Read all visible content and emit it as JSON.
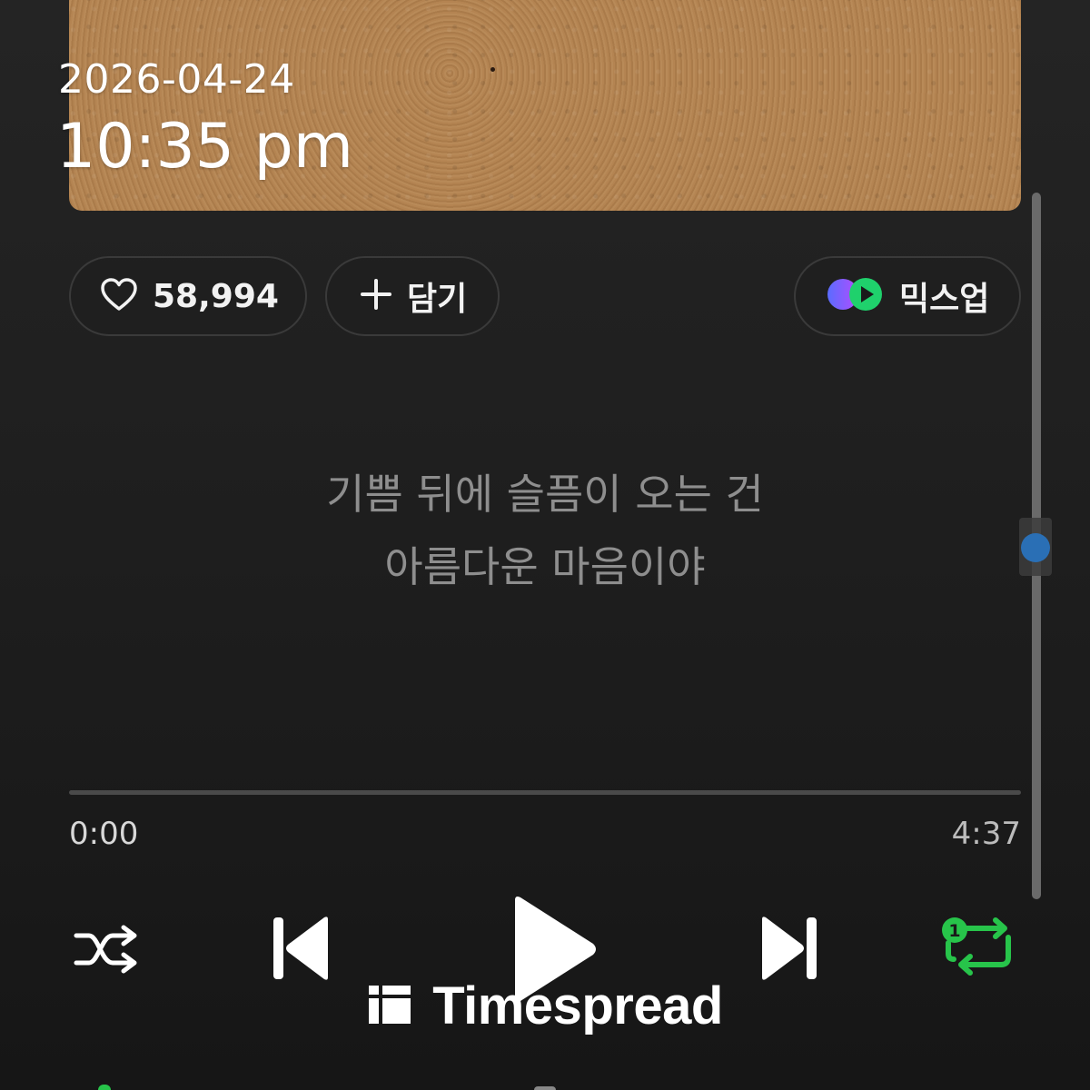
{
  "overlay": {
    "date": "2026-04-24",
    "time": "10:35 pm"
  },
  "actions": {
    "like_count": "58,994",
    "add_label": "담기",
    "mixup_label": "믹스업"
  },
  "lyrics": {
    "line1": "기쁨 뒤에 슬픔이 오는 건",
    "line2": "아름다운 마음이야"
  },
  "player": {
    "elapsed": "0:00",
    "total": "4:37",
    "progress_fraction": 0.0,
    "repeat_mode": "repeat-one",
    "repeat_badge": "1"
  },
  "watermark": {
    "text": "Timespread"
  },
  "colors": {
    "accent_green": "#27c44a",
    "scroll_handle": "#2a6fb5",
    "album_art": "#b48452"
  },
  "icons": {
    "like": "heart-icon",
    "add": "plus-icon",
    "mixup": "mixup-logo-icon",
    "shuffle": "shuffle-icon",
    "previous": "skip-previous-icon",
    "play": "play-icon",
    "next": "skip-next-icon",
    "repeat": "repeat-one-icon",
    "watermark": "timespread-logo-icon"
  }
}
